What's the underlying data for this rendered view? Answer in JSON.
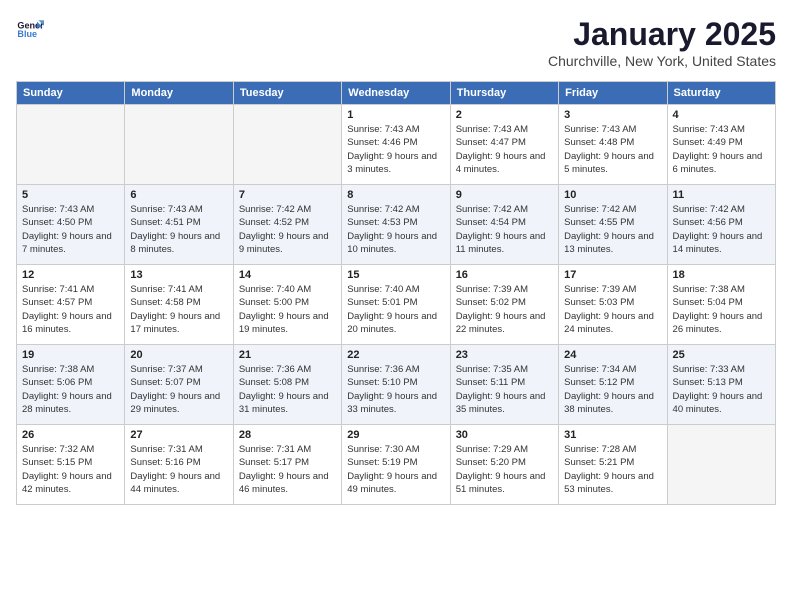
{
  "logo": {
    "line1": "General",
    "line2": "Blue"
  },
  "title": "January 2025",
  "subtitle": "Churchville, New York, United States",
  "headers": [
    "Sunday",
    "Monday",
    "Tuesday",
    "Wednesday",
    "Thursday",
    "Friday",
    "Saturday"
  ],
  "weeks": [
    [
      {
        "num": "",
        "info": ""
      },
      {
        "num": "",
        "info": ""
      },
      {
        "num": "",
        "info": ""
      },
      {
        "num": "1",
        "info": "Sunrise: 7:43 AM\nSunset: 4:46 PM\nDaylight: 9 hours and 3 minutes."
      },
      {
        "num": "2",
        "info": "Sunrise: 7:43 AM\nSunset: 4:47 PM\nDaylight: 9 hours and 4 minutes."
      },
      {
        "num": "3",
        "info": "Sunrise: 7:43 AM\nSunset: 4:48 PM\nDaylight: 9 hours and 5 minutes."
      },
      {
        "num": "4",
        "info": "Sunrise: 7:43 AM\nSunset: 4:49 PM\nDaylight: 9 hours and 6 minutes."
      }
    ],
    [
      {
        "num": "5",
        "info": "Sunrise: 7:43 AM\nSunset: 4:50 PM\nDaylight: 9 hours and 7 minutes."
      },
      {
        "num": "6",
        "info": "Sunrise: 7:43 AM\nSunset: 4:51 PM\nDaylight: 9 hours and 8 minutes."
      },
      {
        "num": "7",
        "info": "Sunrise: 7:42 AM\nSunset: 4:52 PM\nDaylight: 9 hours and 9 minutes."
      },
      {
        "num": "8",
        "info": "Sunrise: 7:42 AM\nSunset: 4:53 PM\nDaylight: 9 hours and 10 minutes."
      },
      {
        "num": "9",
        "info": "Sunrise: 7:42 AM\nSunset: 4:54 PM\nDaylight: 9 hours and 11 minutes."
      },
      {
        "num": "10",
        "info": "Sunrise: 7:42 AM\nSunset: 4:55 PM\nDaylight: 9 hours and 13 minutes."
      },
      {
        "num": "11",
        "info": "Sunrise: 7:42 AM\nSunset: 4:56 PM\nDaylight: 9 hours and 14 minutes."
      }
    ],
    [
      {
        "num": "12",
        "info": "Sunrise: 7:41 AM\nSunset: 4:57 PM\nDaylight: 9 hours and 16 minutes."
      },
      {
        "num": "13",
        "info": "Sunrise: 7:41 AM\nSunset: 4:58 PM\nDaylight: 9 hours and 17 minutes."
      },
      {
        "num": "14",
        "info": "Sunrise: 7:40 AM\nSunset: 5:00 PM\nDaylight: 9 hours and 19 minutes."
      },
      {
        "num": "15",
        "info": "Sunrise: 7:40 AM\nSunset: 5:01 PM\nDaylight: 9 hours and 20 minutes."
      },
      {
        "num": "16",
        "info": "Sunrise: 7:39 AM\nSunset: 5:02 PM\nDaylight: 9 hours and 22 minutes."
      },
      {
        "num": "17",
        "info": "Sunrise: 7:39 AM\nSunset: 5:03 PM\nDaylight: 9 hours and 24 minutes."
      },
      {
        "num": "18",
        "info": "Sunrise: 7:38 AM\nSunset: 5:04 PM\nDaylight: 9 hours and 26 minutes."
      }
    ],
    [
      {
        "num": "19",
        "info": "Sunrise: 7:38 AM\nSunset: 5:06 PM\nDaylight: 9 hours and 28 minutes."
      },
      {
        "num": "20",
        "info": "Sunrise: 7:37 AM\nSunset: 5:07 PM\nDaylight: 9 hours and 29 minutes."
      },
      {
        "num": "21",
        "info": "Sunrise: 7:36 AM\nSunset: 5:08 PM\nDaylight: 9 hours and 31 minutes."
      },
      {
        "num": "22",
        "info": "Sunrise: 7:36 AM\nSunset: 5:10 PM\nDaylight: 9 hours and 33 minutes."
      },
      {
        "num": "23",
        "info": "Sunrise: 7:35 AM\nSunset: 5:11 PM\nDaylight: 9 hours and 35 minutes."
      },
      {
        "num": "24",
        "info": "Sunrise: 7:34 AM\nSunset: 5:12 PM\nDaylight: 9 hours and 38 minutes."
      },
      {
        "num": "25",
        "info": "Sunrise: 7:33 AM\nSunset: 5:13 PM\nDaylight: 9 hours and 40 minutes."
      }
    ],
    [
      {
        "num": "26",
        "info": "Sunrise: 7:32 AM\nSunset: 5:15 PM\nDaylight: 9 hours and 42 minutes."
      },
      {
        "num": "27",
        "info": "Sunrise: 7:31 AM\nSunset: 5:16 PM\nDaylight: 9 hours and 44 minutes."
      },
      {
        "num": "28",
        "info": "Sunrise: 7:31 AM\nSunset: 5:17 PM\nDaylight: 9 hours and 46 minutes."
      },
      {
        "num": "29",
        "info": "Sunrise: 7:30 AM\nSunset: 5:19 PM\nDaylight: 9 hours and 49 minutes."
      },
      {
        "num": "30",
        "info": "Sunrise: 7:29 AM\nSunset: 5:20 PM\nDaylight: 9 hours and 51 minutes."
      },
      {
        "num": "31",
        "info": "Sunrise: 7:28 AM\nSunset: 5:21 PM\nDaylight: 9 hours and 53 minutes."
      },
      {
        "num": "",
        "info": ""
      }
    ]
  ]
}
